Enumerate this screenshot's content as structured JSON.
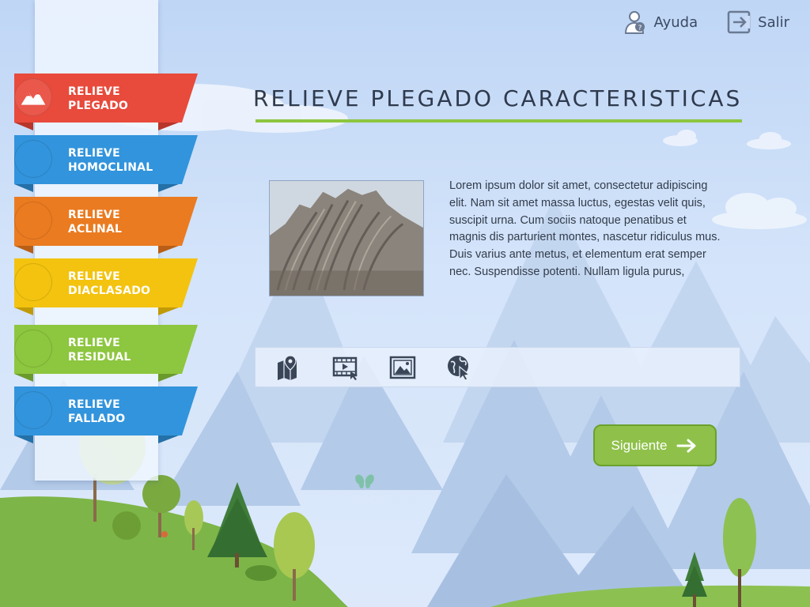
{
  "header": {
    "help_label": "Ayuda",
    "exit_label": "Salir"
  },
  "sidebar": {
    "items": [
      {
        "line1": "RELIEVE",
        "line2": "PLEGADO",
        "color": "#e84a3c",
        "dark": "#b8352a",
        "icon": "mountain-icon"
      },
      {
        "line1": "RELIEVE",
        "line2": "HOMOCLINAL",
        "color": "#3294dc",
        "dark": "#2470a8",
        "icon": ""
      },
      {
        "line1": "RELIEVE",
        "line2": "ACLINAL",
        "color": "#ea7b21",
        "dark": "#b85e16",
        "icon": ""
      },
      {
        "line1": "RELIEVE",
        "line2": "DIACLASADO",
        "color": "#f3c30f",
        "dark": "#c19a08",
        "icon": ""
      },
      {
        "line1": "RELIEVE",
        "line2": "RESIDUAL",
        "color": "#8dc63f",
        "dark": "#6a9a2c",
        "icon": ""
      },
      {
        "line1": "RELIEVE",
        "line2": "FALLADO",
        "color": "#3294dc",
        "dark": "#2470a8",
        "icon": ""
      }
    ]
  },
  "main": {
    "title": "RELIEVE PLEGADO CARACTERISTICAS",
    "paragraph": "Lorem ipsum dolor sit amet, consectetur adipiscing elit. Nam sit amet massa luctus, egestas velit quis, suscipit urna. Cum sociis natoque penatibus et magnis dis parturient montes, nascetur ridiculus mus. Duis varius ante metus, et elementum erat semper nec. Suspendisse potenti. Nullam ligula purus,",
    "tools": [
      "map-pin-icon",
      "video-play-icon",
      "image-gallery-icon",
      "globe-cursor-icon"
    ],
    "next_label": "Siguiente"
  },
  "colors": {
    "accent_green": "#8dc63f",
    "text_dark": "#2f3a4d"
  }
}
